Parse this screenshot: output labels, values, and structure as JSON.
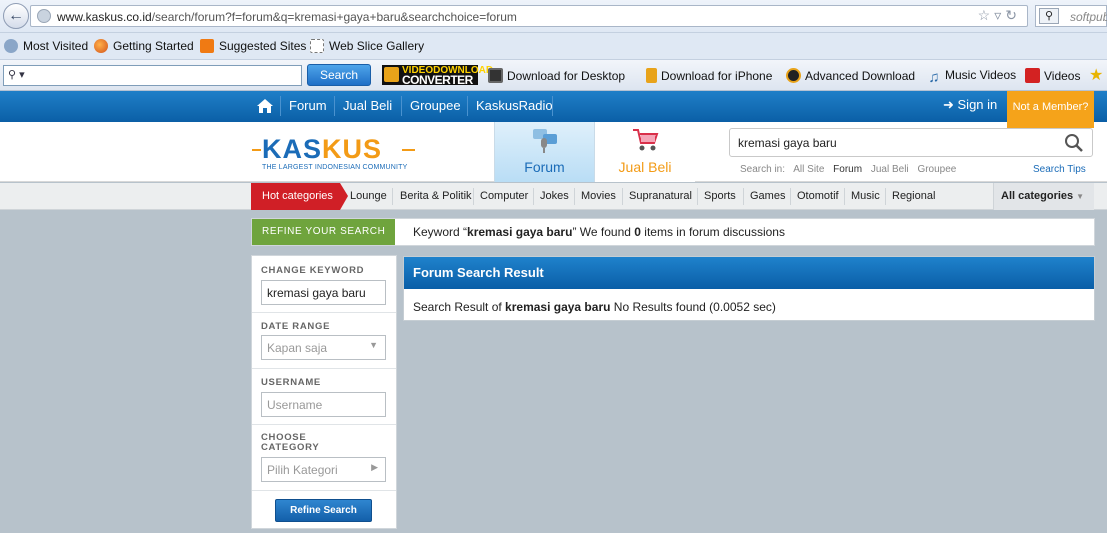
{
  "browser": {
    "url_domain": "www.kaskus.co.id",
    "url_path": "/search/forum?f=forum&q=kremasi+gaya+baru&searchchoice=forum",
    "search_engine_text": "softpub",
    "bookmarks": [
      "Most Visited",
      "Getting Started",
      "Suggested Sites",
      "Web Slice Gallery"
    ],
    "toolbar": {
      "search_button": "Search",
      "vdc_line1": "VIDEODOWNLOAD",
      "vdc_line2": "CONVERTER",
      "items": [
        "Download for Desktop",
        "Download for iPhone",
        "Advanced Download",
        "Music Videos",
        "Videos"
      ]
    }
  },
  "site": {
    "topnav": [
      "Forum",
      "Jual Beli",
      "Groupee",
      "KaskusRadio"
    ],
    "sign_in": "Sign in",
    "not_member": "Not a Member?",
    "logo_word_1": "KAS",
    "logo_word_2": "KUS",
    "logo_tagline": "THE LARGEST INDONESIAN COMMUNITY",
    "tabs": {
      "forum": "Forum",
      "jualbeli": "Jual Beli"
    },
    "search_value": "kremasi gaya baru",
    "search_in_label": "Search in:",
    "search_in_options": [
      "All Site",
      "Forum",
      "Jual Beli",
      "Groupee"
    ],
    "search_tips": "Search Tips",
    "hot_categories": "Hot categories",
    "categories": [
      "Lounge",
      "Berita & Politik",
      "Computer",
      "Jokes",
      "Movies",
      "Supranatural",
      "Sports",
      "Games",
      "Otomotif",
      "Music",
      "Regional"
    ],
    "all_categories": "All categories",
    "refine_tag": "REFINE YOUR SEARCH",
    "keyword_prefix": "Keyword “",
    "keyword": "kremasi gaya baru",
    "keyword_mid": "” We found ",
    "found_count": "0",
    "keyword_suffix": " items in forum discussions",
    "refine": {
      "change_keyword_label": "CHANGE KEYWORD",
      "keyword_value": "kremasi gaya baru",
      "date_range_label": "DATE RANGE",
      "date_range_value": "Kapan saja",
      "username_label": "USERNAME",
      "username_placeholder": "Username",
      "category_label_1": "CHOOSE",
      "category_label_2": "CATEGORY",
      "category_value": "Pilih Kategori",
      "button": "Refine Search"
    },
    "result": {
      "title": "Forum Search Result",
      "prefix": "Search Result of ",
      "keyword": "kremasi gaya baru",
      "suffix": " No Results found (0.0052 sec)"
    }
  }
}
